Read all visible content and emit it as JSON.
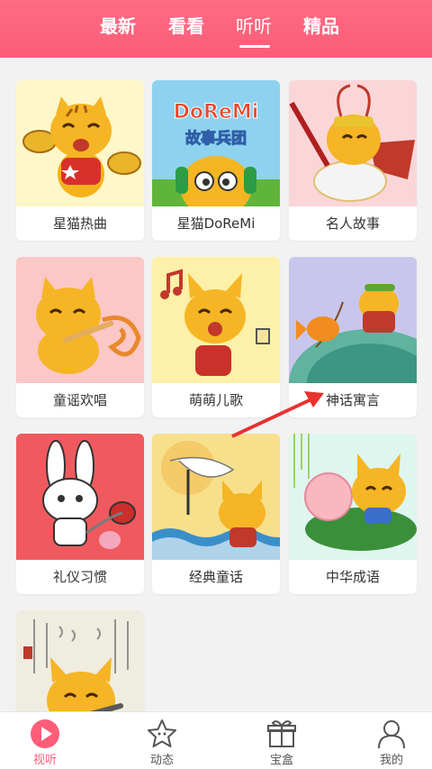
{
  "colors": {
    "accent": "#ff5d78",
    "header": "#fb5d78",
    "background": "#f2f2f2",
    "card": "#ffffff"
  },
  "header": {
    "tabs": [
      {
        "label": "最新",
        "active": false
      },
      {
        "label": "看看",
        "active": false
      },
      {
        "label": "听听",
        "active": true
      },
      {
        "label": "精品",
        "active": false
      }
    ]
  },
  "categories": [
    {
      "label": "星猫热曲",
      "image": "cat-with-cymbals"
    },
    {
      "label": "星猫DoReMi",
      "image": "doremi-story-cat",
      "title_text": "DoReMi",
      "subtitle_text": "故事兵团"
    },
    {
      "label": "名人故事",
      "image": "monkey-king-cat"
    },
    {
      "label": "童谣欢唱",
      "image": "cat-playing-flute"
    },
    {
      "label": "萌萌儿歌",
      "image": "singing-cat-with-note"
    },
    {
      "label": "神话寓言",
      "image": "fishing-cat-with-goldfish"
    },
    {
      "label": "礼仪习惯",
      "image": "bunny-with-vacuum"
    },
    {
      "label": "经典童话",
      "image": "cat-with-crane"
    },
    {
      "label": "中华成语",
      "image": "cat-with-peach-on-leaf"
    },
    {
      "label": "",
      "image": "calligraphy-cat"
    }
  ],
  "bottom_nav": [
    {
      "label": "视听",
      "icon": "play-circle-icon",
      "active": true
    },
    {
      "label": "动态",
      "icon": "star-icon",
      "active": false
    },
    {
      "label": "宝盒",
      "icon": "gift-box-icon",
      "active": false
    },
    {
      "label": "我的",
      "icon": "person-icon",
      "active": false
    }
  ]
}
